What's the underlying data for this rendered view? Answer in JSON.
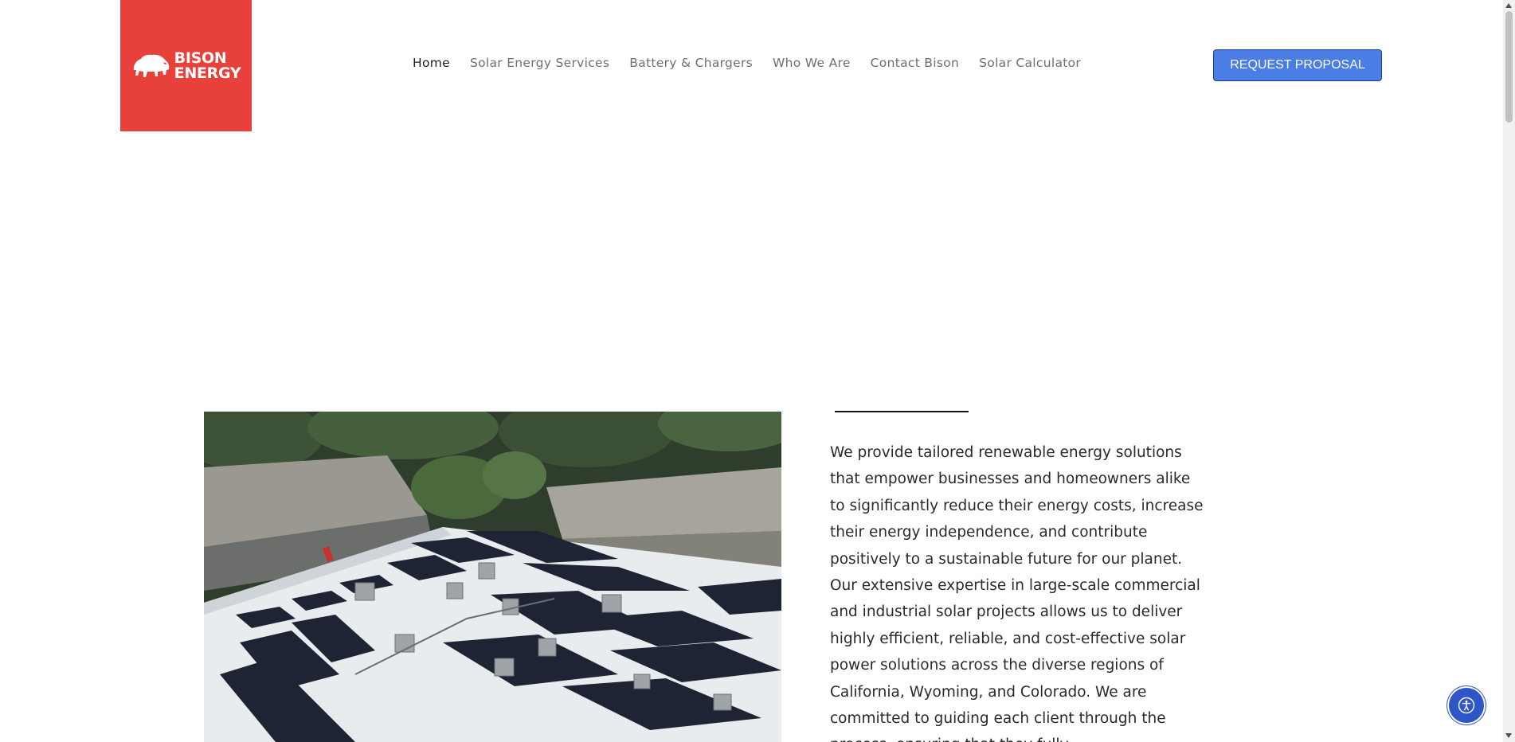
{
  "brand": {
    "name_line1": "BISON",
    "name_line2": "ENERGY",
    "logo_icon": "bison-icon",
    "bg_color": "#e8403a"
  },
  "nav": {
    "items": [
      {
        "label": "Home",
        "active": true
      },
      {
        "label": "Solar Energy Services",
        "active": false
      },
      {
        "label": "Battery & Chargers",
        "active": false
      },
      {
        "label": "Who We Are",
        "active": false
      },
      {
        "label": "Contact Bison",
        "active": false
      },
      {
        "label": "Solar Calculator",
        "active": false
      }
    ]
  },
  "cta": {
    "label": "REQUEST PROPOSAL",
    "color": "#4a7de6"
  },
  "intro": {
    "text": "We provide tailored renewable energy solutions that empower businesses and homeowners alike to significantly reduce their energy costs, increase their energy independence, and contribute positively to a sustainable future for our planet. Our extensive expertise in large-scale commercial and industrial solar projects allows us to deliver highly efficient, reliable, and cost-effective solar power solutions across the diverse regions of California, Wyoming, and Colorado. We are committed to guiding each client through the process, ensuring that they fully"
  },
  "widgets": {
    "accessibility_icon": "accessibility-icon",
    "accent_color": "#2f56c6"
  }
}
